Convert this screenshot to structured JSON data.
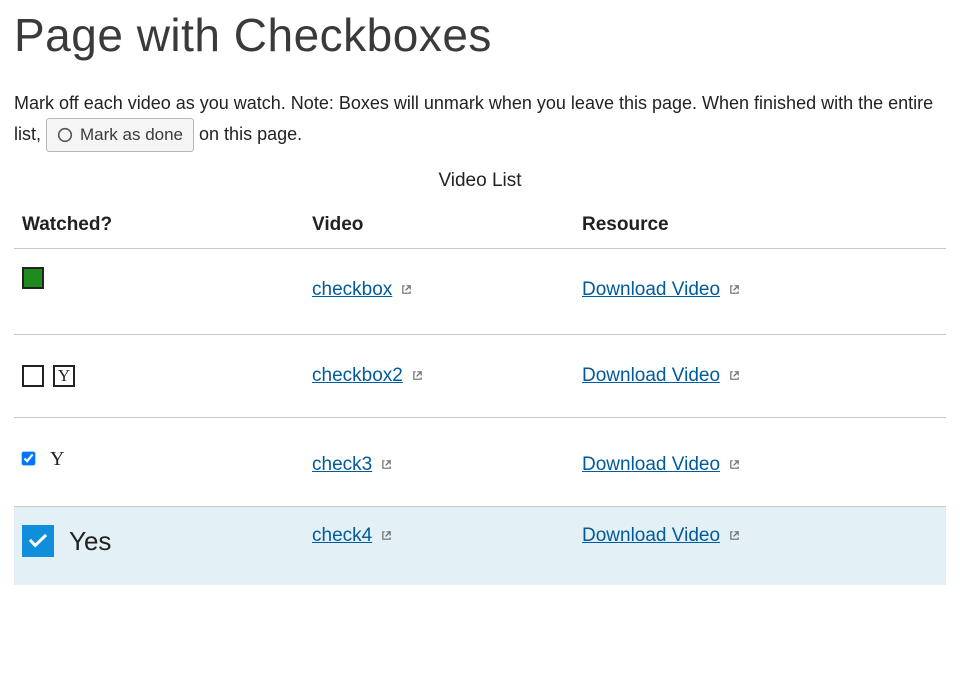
{
  "page": {
    "title": "Page with Checkboxes",
    "intro_part1": "Mark off each video as you watch. Note: Boxes will unmark when you leave this page. When finished with the entire list, ",
    "intro_part2": " on this page.",
    "mark_done_label": "Mark as done"
  },
  "table": {
    "caption": "Video List",
    "headers": {
      "watched": "Watched?",
      "video": "Video",
      "resource": "Resource"
    },
    "rows": [
      {
        "checkbox_style": "green-filled",
        "checked": true,
        "watched_label": "",
        "video_label": "checkbox",
        "resource_label": "Download Video",
        "highlighted": false
      },
      {
        "checkbox_style": "empty-with-boxed-Y",
        "checked": false,
        "watched_label": "Y",
        "video_label": "checkbox2",
        "resource_label": "Download Video",
        "highlighted": false
      },
      {
        "checkbox_style": "native-checked",
        "checked": true,
        "watched_label": "Y",
        "video_label": "check3",
        "resource_label": "Download Video",
        "highlighted": false
      },
      {
        "checkbox_style": "blue-checked",
        "checked": true,
        "watched_label": "Yes",
        "video_label": "check4",
        "resource_label": "Download Video",
        "highlighted": true
      }
    ]
  },
  "colors": {
    "link": "#005a9c",
    "highlight_bg": "#e3f0f5",
    "green_checkbox": "#1f8b1f",
    "blue_checkbox": "#0f8edc"
  }
}
